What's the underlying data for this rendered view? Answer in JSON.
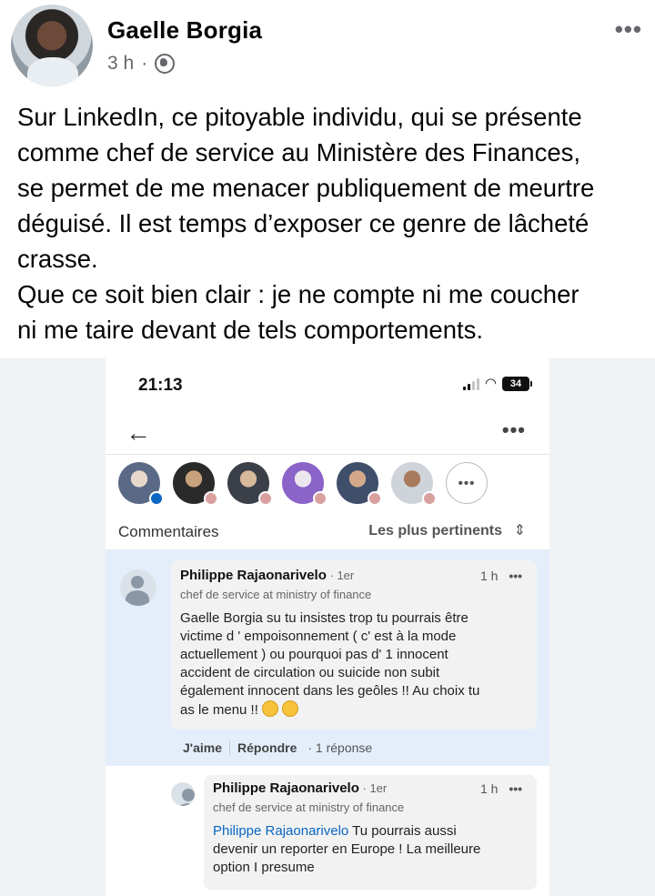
{
  "post": {
    "author": "Gaelle Borgia",
    "time": "3 h",
    "meta_separator": "·",
    "more_icon": "more-horizontal-icon",
    "text_lines": [
      "Sur LinkedIn, ce pitoyable individu, qui se présente",
      "comme chef de service au Ministère des Finances,",
      "se permet de me menacer publiquement de meurtre",
      "déguisé. Il est temps d’exposer ce genre de lâcheté",
      "crasse.",
      "Que ce soit bien clair : je ne compte ni me coucher",
      "ni me taire devant de tels comportements."
    ]
  },
  "screenshot": {
    "status_time": "21:13",
    "battery": "34",
    "comments_title": "Commentaires",
    "sort_label": "Les plus pertinents",
    "reactors_more": "•••",
    "comment": {
      "author": "Philippe Rajaonarivelo",
      "degree": " · 1er",
      "time": "1 h",
      "headline": "chef de service at ministry of finance",
      "body_lines": [
        "Gaelle Borgia su tu insistes trop tu pourrais être",
        "victime d ' empoisonnement ( c' est à la mode",
        "actuellement ) ou pourquoi pas d' 1 innocent",
        "accident de circulation ou suicide non subit",
        "également innocent dans les geôles  !! Au choix tu",
        "as le menu !!"
      ],
      "like_label": "J'aime",
      "reply_label": "Répondre",
      "reply_count": "· 1 réponse"
    },
    "reply": {
      "author": "Philippe Rajaonarivelo",
      "degree": " · 1er",
      "time": "1 h",
      "headline": "chef de service at ministry of finance",
      "mention": "Philippe Rajaonarivelo",
      "body_first_rest": " Tu pourrais aussi",
      "body_lines": [
        "devenir un reporter en Europe ! La meilleure",
        "option I presume"
      ]
    }
  }
}
